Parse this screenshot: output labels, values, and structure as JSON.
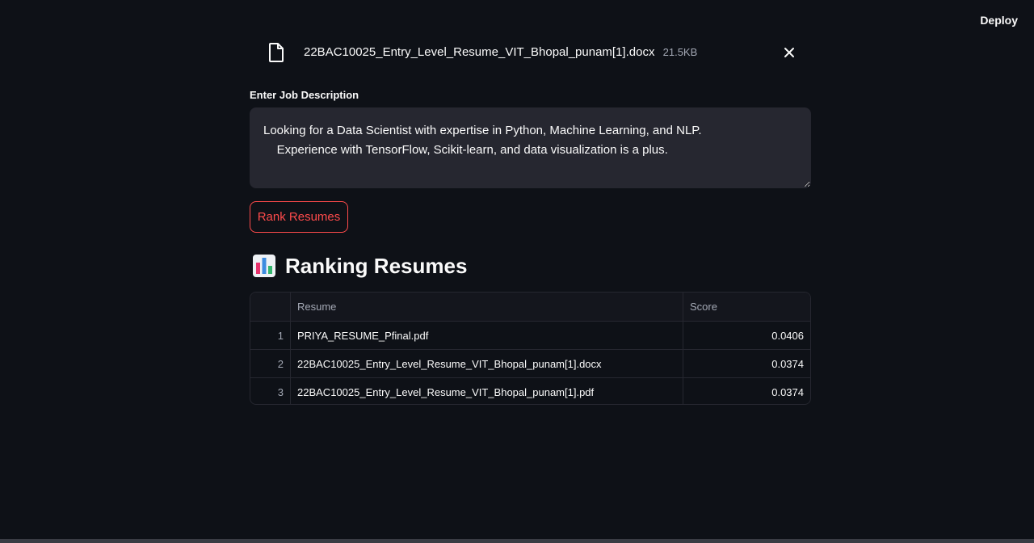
{
  "header": {
    "deploy_label": "Deploy"
  },
  "uploaded_file": {
    "name": "22BAC10025_Entry_Level_Resume_VIT_Bhopal_punam[1].docx",
    "size": "21.5KB"
  },
  "job_description": {
    "label": "Enter Job Description",
    "value": "Looking for a Data Scientist with expertise in Python, Machine Learning, and NLP.\n    Experience with TensorFlow, Scikit-learn, and data visualization is a plus."
  },
  "rank_button_label": "Rank Resumes",
  "ranking": {
    "title": "Ranking Resumes",
    "columns": [
      "",
      "Resume",
      "Score"
    ],
    "rows": [
      {
        "index": "1",
        "resume": "PRIYA_RESUME_Pfinal.pdf",
        "score": "0.0406"
      },
      {
        "index": "2",
        "resume": "22BAC10025_Entry_Level_Resume_VIT_Bhopal_punam[1].docx",
        "score": "0.0374"
      },
      {
        "index": "3",
        "resume": "22BAC10025_Entry_Level_Resume_VIT_Bhopal_punam[1].pdf",
        "score": "0.0374"
      }
    ]
  },
  "colors": {
    "background": "#0e1117",
    "accent": "#ff4b4b",
    "input_bg": "#262730"
  }
}
